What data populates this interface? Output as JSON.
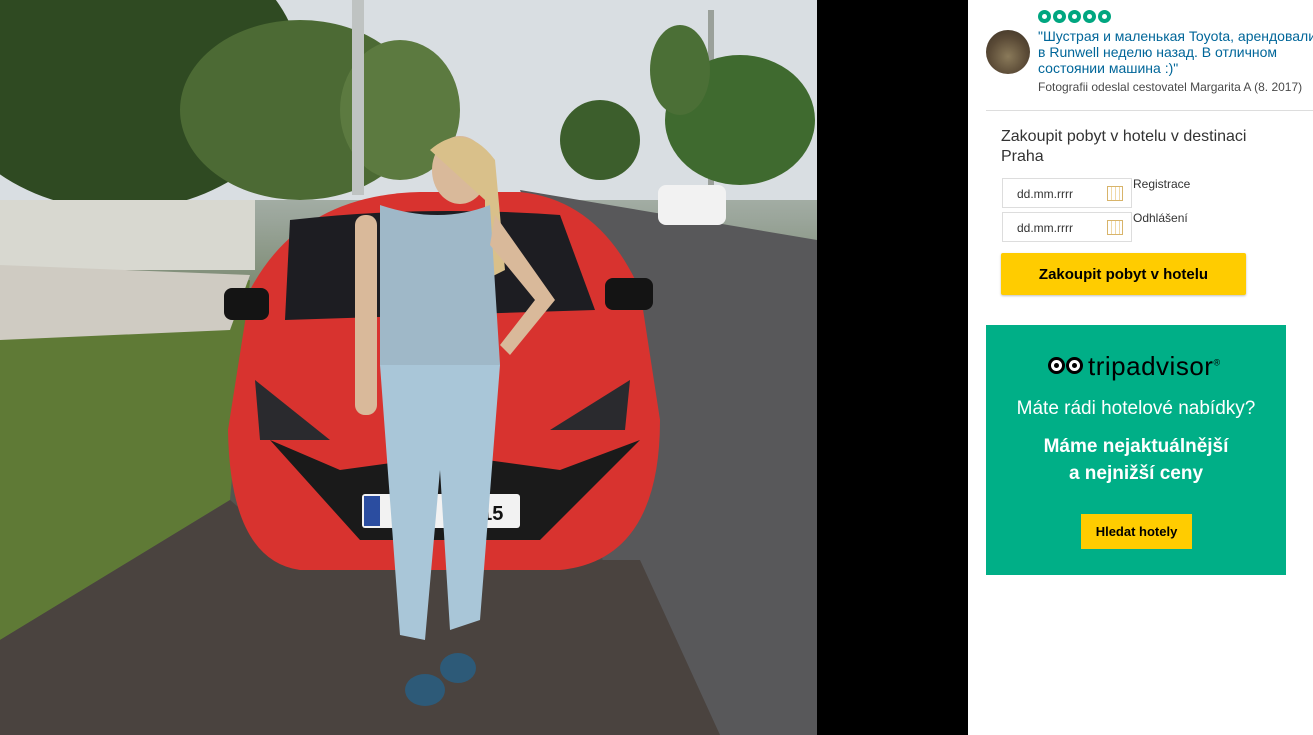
{
  "photo": {
    "alt": "Woman leaning on a red Toyota Aygo"
  },
  "review": {
    "rating": 5,
    "quote": "\"Шустрая и маленькая Toyota, арендовали в Runwell неделю назад. В отличном состоянии машина :)\"",
    "byline": "Fotografii odeslal cestovatel Margarita A (8. 2017)"
  },
  "booking": {
    "title": "Zakoupit pobyt v hotelu v destinaci Praha",
    "checkin_placeholder": "dd.mm.rrrr",
    "checkin_label": "Registrace",
    "checkout_placeholder": "dd.mm.rrrr",
    "checkout_label": "Odhlášení",
    "button_label": "Zakoupit pobyt v hotelu"
  },
  "ad": {
    "brand": "tripadvisor",
    "brand_mark": "®",
    "question": "Máte rádi hotelové nabídky?",
    "line1": "Máme nejaktuálnější",
    "line2": "a nejnižší ceny",
    "button_label": "Hledat hotely",
    "background": "#00af87",
    "button_color": "#ffcc00"
  },
  "colors": {
    "rating_green": "#00a680",
    "link_blue": "#006699",
    "cta_yellow": "#ffcc00"
  },
  "icons": [
    "calendar-icon",
    "tripadvisor-owl-icon",
    "rating-bubble-icon"
  ]
}
